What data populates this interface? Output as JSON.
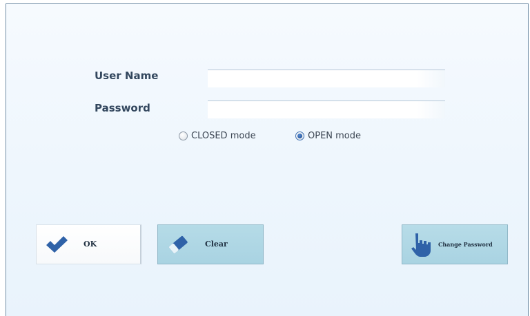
{
  "form": {
    "username_label": "User Name",
    "username_value": "",
    "password_label": "Password",
    "password_value": ""
  },
  "mode": {
    "options": [
      {
        "label": "CLOSED mode",
        "selected": false
      },
      {
        "label": "OPEN mode",
        "selected": true
      }
    ]
  },
  "buttons": {
    "ok_label": "OK",
    "clear_label": "Clear",
    "change_password_label": "Change Password"
  },
  "icons": {
    "ok": "checkmark-icon",
    "clear": "eraser-icon",
    "change_password": "hand-pointer-icon"
  },
  "colors": {
    "accent": "#2f62a8",
    "button_teal": "#aed7e5",
    "label_text": "#33475e"
  }
}
